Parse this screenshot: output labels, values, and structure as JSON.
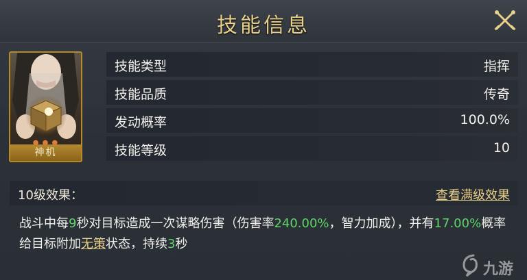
{
  "header": {
    "title": "技能信息",
    "close_icon": "close-crossed-swords-icon"
  },
  "card": {
    "name": "神机",
    "portrait": "character-holding-glowing-cube",
    "dots": "● ● ●"
  },
  "info": {
    "rows": [
      {
        "label": "技能类型",
        "value": "指挥"
      },
      {
        "label": "技能品质",
        "value": "传奇"
      },
      {
        "label": "发动概率",
        "value": "100.0%"
      },
      {
        "label": "技能等级",
        "value": "10"
      }
    ]
  },
  "effect": {
    "level_label": "10级效果：",
    "full_link": "查看满级效果",
    "desc": {
      "p1": "战斗中每",
      "n1": "9",
      "p2": "秒对目标造成一次谋略伤害（伤害率",
      "n2": "240.00%",
      "p3": "，智力加成），并有",
      "n3": "17.00%",
      "p4": "概率给目标附加",
      "status": "无策",
      "p5": "状态，持续",
      "n4": "3",
      "p6": "秒"
    }
  },
  "watermark": {
    "text": "九游"
  },
  "colors": {
    "gold": "#e8cf8a",
    "highlight_green": "#5fd46a",
    "row_bg": "#242830",
    "panel_bg": "#2c3139"
  }
}
